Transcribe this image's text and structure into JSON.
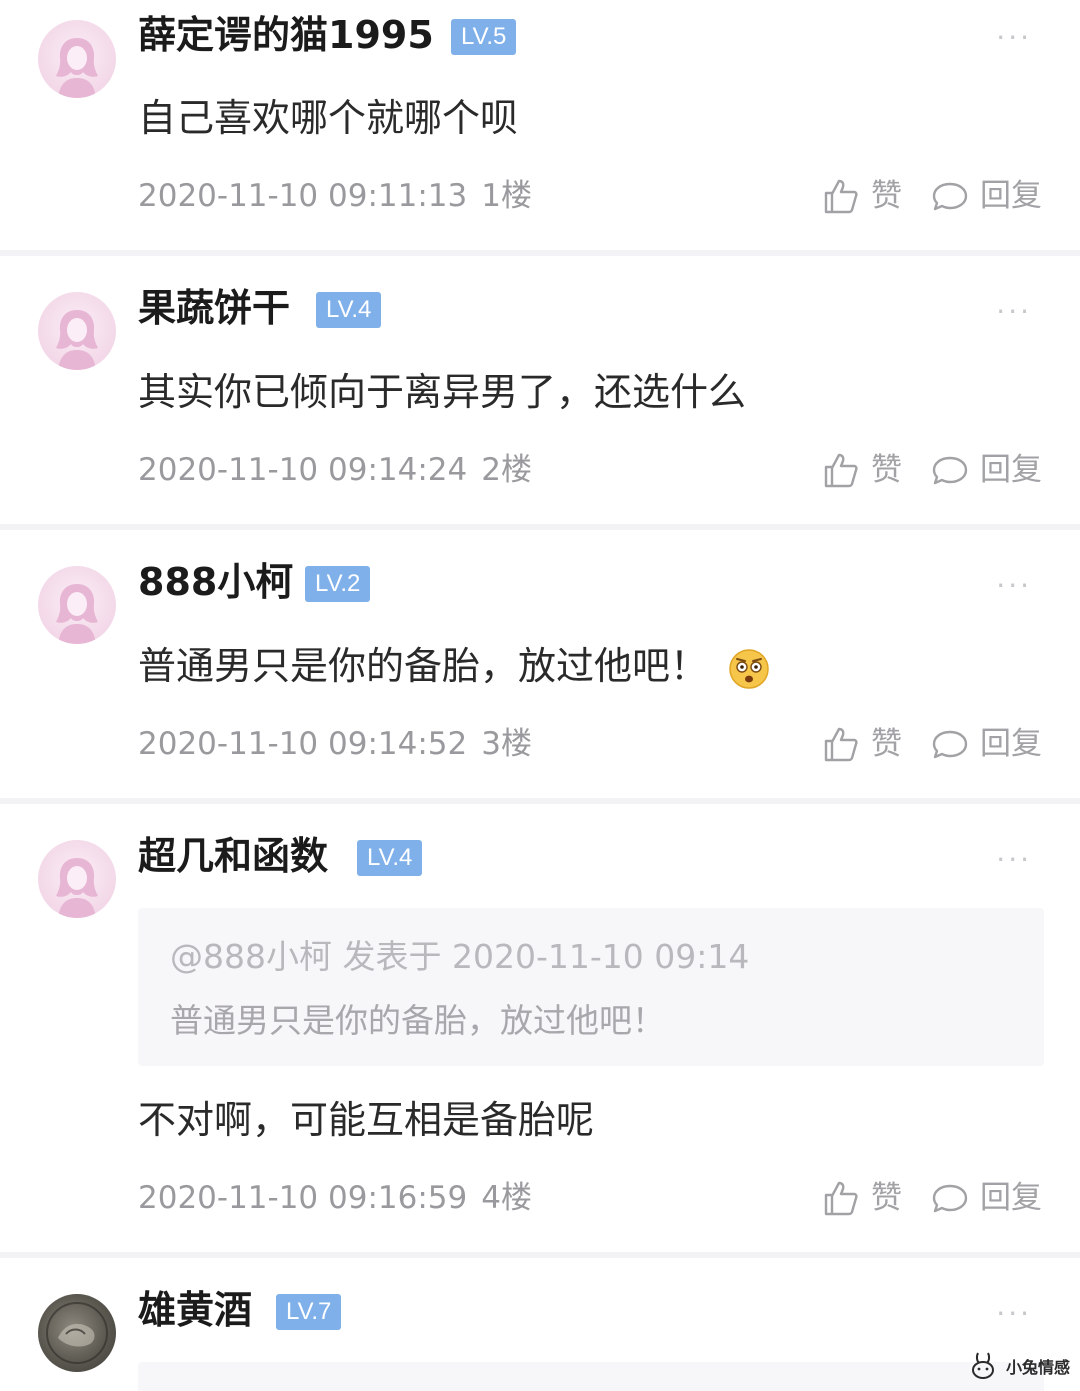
{
  "comments": [
    {
      "username": "薛定谔的猫1995",
      "level": "LV.5",
      "content": "自己喜欢哪个就哪个呗",
      "timestamp": "2020-11-10 09:11:13",
      "floor": "1楼"
    },
    {
      "username": "果蔬饼干",
      "level": "LV.4",
      "content": "其实你已倾向于离异男了，还选什么",
      "timestamp": "2020-11-10 09:14:24",
      "floor": "2楼"
    },
    {
      "username": "888小柯",
      "level": "LV.2",
      "content": "普通男只是你的备胎，放过他吧！",
      "emoji": "shocked-face-icon",
      "timestamp": "2020-11-10 09:14:52",
      "floor": "3楼"
    },
    {
      "username": "超几和函数",
      "level": "LV.4",
      "quote": {
        "header": "@888小柯 发表于 2020-11-10 09:14",
        "text": "普通男只是你的备胎，放过他吧！"
      },
      "content": "不对啊，可能互相是备胎呢",
      "timestamp": "2020-11-10 09:16:59",
      "floor": "4楼"
    },
    {
      "username": "雄黄酒",
      "level": "LV.7"
    }
  ],
  "actions": {
    "like_label": "赞",
    "reply_label": "回复",
    "more_label": "···"
  },
  "watermark": {
    "text": "小兔情感"
  },
  "colors": {
    "level_badge": "#7fb0ea",
    "meta_text": "#9a9a9e",
    "background": "#f3f3f5"
  }
}
